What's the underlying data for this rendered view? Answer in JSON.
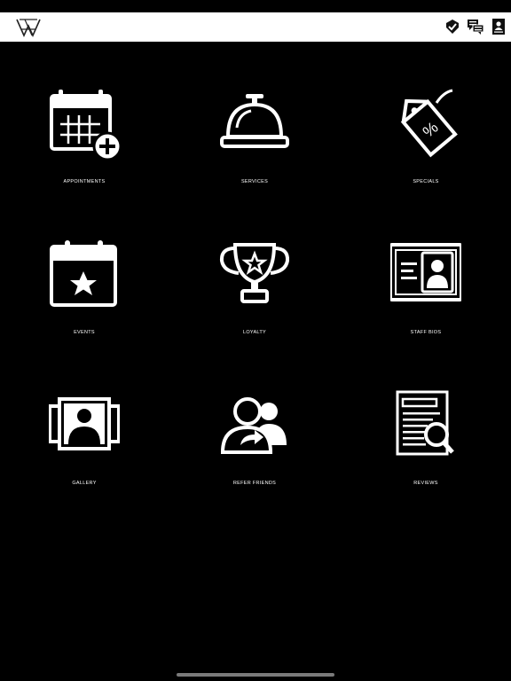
{
  "header": {
    "logo_icon": "brand-logo-icon",
    "actions": [
      {
        "icon": "badge-check-icon"
      },
      {
        "icon": "chat-bubbles-icon"
      },
      {
        "icon": "contact-card-icon"
      }
    ],
    "background": "#ffffff"
  },
  "menu": {
    "items": [
      {
        "label": "APPOINTMENTS",
        "icon": "calendar-add-icon"
      },
      {
        "label": "SERVICES",
        "icon": "service-bell-icon"
      },
      {
        "label": "SPECIALS",
        "icon": "price-tag-icon"
      },
      {
        "label": "EVENTS",
        "icon": "calendar-star-icon"
      },
      {
        "label": "LOYALTY",
        "icon": "trophy-icon"
      },
      {
        "label": "STAFF BIOS",
        "icon": "id-card-icon"
      },
      {
        "label": "GALLERY",
        "icon": "photo-gallery-icon"
      },
      {
        "label": "REFER FRIENDS",
        "icon": "refer-friends-icon"
      },
      {
        "label": "REVIEWS",
        "icon": "document-search-icon"
      }
    ]
  },
  "colors": {
    "background": "#000000",
    "icon": "#ffffff",
    "text": "#ffffff"
  }
}
